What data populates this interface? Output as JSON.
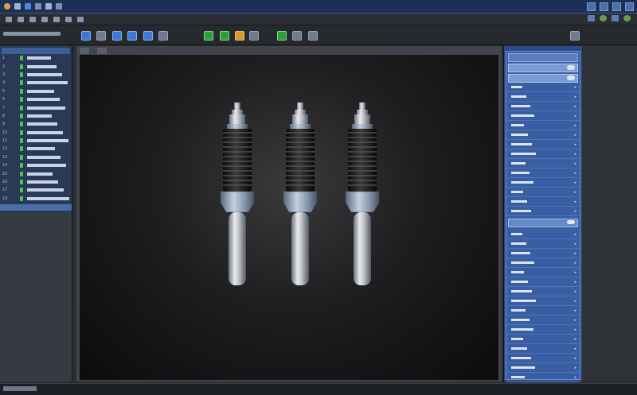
{
  "titlebar": {
    "icons": [
      "app-logo-icon",
      "folder-icon",
      "save-icon",
      "undo-icon",
      "redo-icon",
      "render-icon"
    ]
  },
  "toolbar": {
    "tools": [
      {
        "name": "select-tool-icon",
        "color": "blue"
      },
      {
        "name": "move-tool-icon",
        "color": "gray"
      },
      {
        "name": "rotate-tool-icon",
        "color": "blue"
      },
      {
        "name": "scale-tool-icon",
        "color": "blue"
      },
      {
        "name": "mirror-tool-icon",
        "color": "blue"
      },
      {
        "name": "snap-tool-icon",
        "color": "gray"
      },
      {
        "name": "measure-tool-icon",
        "color": "green"
      },
      {
        "name": "material-tool-icon",
        "color": "green"
      },
      {
        "name": "light-tool-icon",
        "color": "amber"
      },
      {
        "name": "camera-tool-icon",
        "color": "gray"
      },
      {
        "name": "shade-tool-icon",
        "color": "green"
      },
      {
        "name": "wire-tool-icon",
        "color": "gray"
      },
      {
        "name": "grid-tool-icon",
        "color": "gray"
      }
    ]
  },
  "colors": {
    "accent": "#3b79d7",
    "green": "#2d9e39",
    "panel": "#3a5ea3",
    "titlebar": "#1b2f57"
  },
  "tree": {
    "rows": [
      {
        "num": "1",
        "label": ""
      },
      {
        "num": "2",
        "label": ""
      },
      {
        "num": "3",
        "label": ""
      },
      {
        "num": "4",
        "label": ""
      },
      {
        "num": "5",
        "label": ""
      },
      {
        "num": "6",
        "label": ""
      },
      {
        "num": "7",
        "label": ""
      },
      {
        "num": "8",
        "label": ""
      },
      {
        "num": "9",
        "label": ""
      },
      {
        "num": "10",
        "label": ""
      },
      {
        "num": "11",
        "label": ""
      },
      {
        "num": "12",
        "label": ""
      },
      {
        "num": "13",
        "label": ""
      },
      {
        "num": "14",
        "label": ""
      },
      {
        "num": "15",
        "label": ""
      },
      {
        "num": "16",
        "label": ""
      },
      {
        "num": "17",
        "label": ""
      },
      {
        "num": "18",
        "label": ""
      }
    ]
  },
  "viewport": {
    "tabs": [
      "",
      ""
    ],
    "objects": [
      "shock-absorber-1",
      "shock-absorber-2",
      "shock-absorber-3"
    ]
  },
  "properties": {
    "rows_top": [
      "",
      "",
      "",
      "",
      "",
      "",
      "",
      "",
      "",
      "",
      "",
      "",
      "",
      ""
    ],
    "rows_bottom": [
      "",
      "",
      "",
      "",
      "",
      "",
      "",
      "",
      "",
      "",
      "",
      "",
      "",
      "",
      "",
      "",
      ""
    ]
  },
  "status": {
    "right_text": ""
  }
}
